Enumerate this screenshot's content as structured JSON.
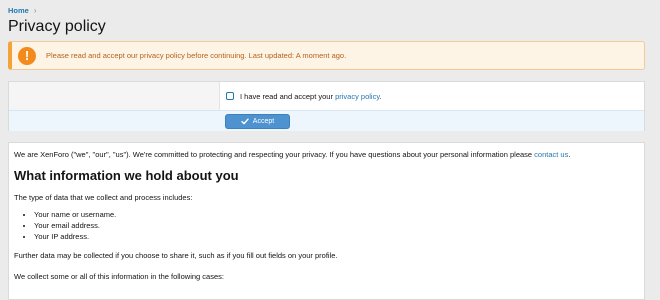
{
  "breadcrumb": {
    "home": "Home",
    "separator": "›"
  },
  "page": {
    "title": "Privacy policy"
  },
  "notice": {
    "icon": "!",
    "text": "Please read and accept our privacy policy before continuing. Last updated: A moment ago."
  },
  "form": {
    "checkbox_label_prefix": "I have read and accept your ",
    "checkbox_link": "privacy policy",
    "checkbox_label_suffix": ".",
    "checkbox_checked": false,
    "accept_label": "Accept"
  },
  "content": {
    "intro_prefix": "We are XenForo (\"we\", \"our\", \"us\"). We're committed to protecting and respecting your privacy. If you have questions about your personal information please ",
    "intro_link": "contact us",
    "intro_suffix": ".",
    "heading": "What information we hold about you",
    "list_intro": "The type of data that we collect and process includes:",
    "list": [
      "Your name or username.",
      "Your email address.",
      "Your IP address."
    ],
    "further": "Further data may be collected if you choose to share it, such as if you fill out fields on your profile.",
    "cases": "We collect some or all of this information in the following cases:"
  },
  "colors": {
    "link": "#2577b1",
    "notice_bg": "#fef4e6",
    "notice_icon": "#f28a1c",
    "button": "#4e92d0"
  }
}
